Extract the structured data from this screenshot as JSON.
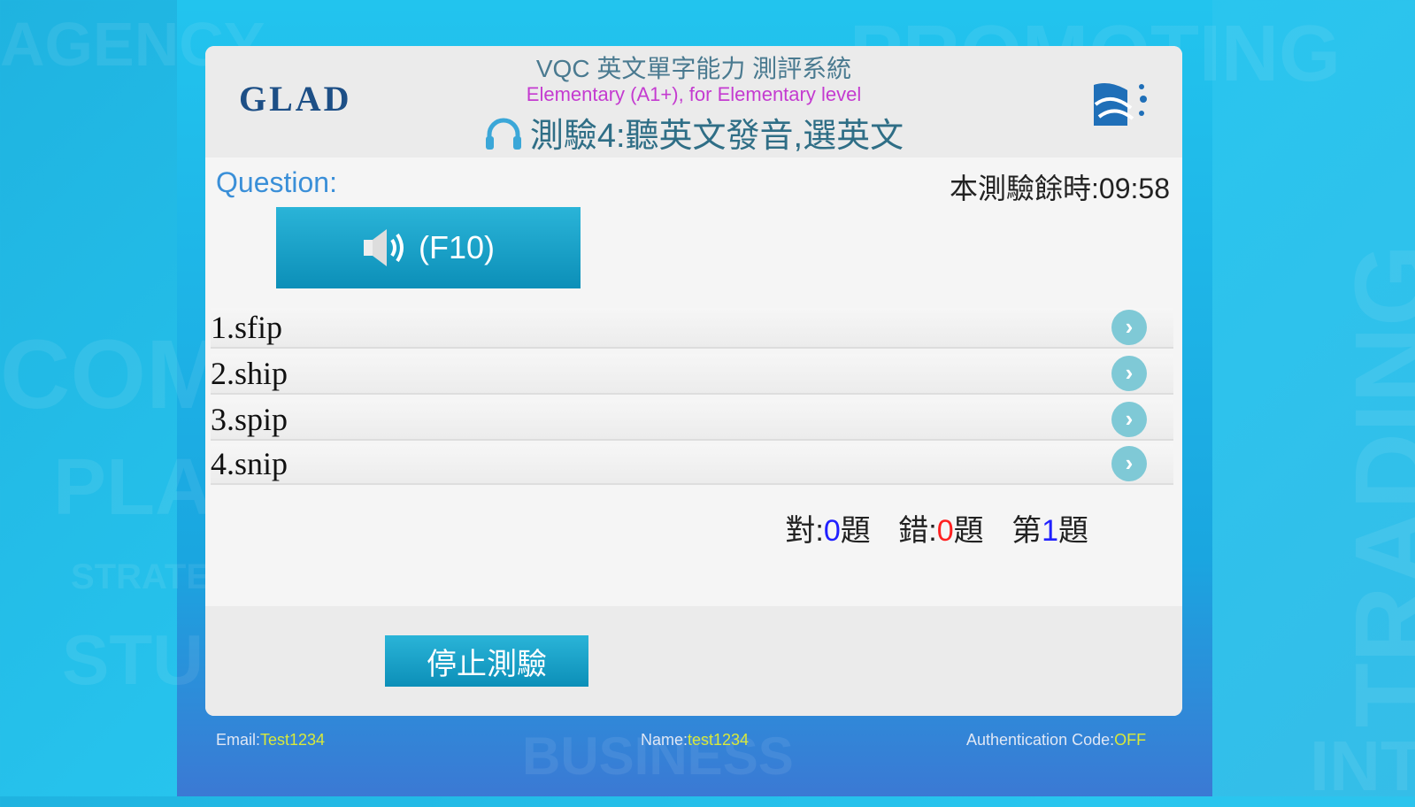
{
  "header": {
    "title": "VQC 英文單字能力 測評系統",
    "level": "Elementary (A1+), for Elementary level",
    "test": "測驗4:聽英文發音,選英文",
    "logo": "GLAD"
  },
  "question_label": "Question:",
  "timer": "本測驗餘時:09:58",
  "play_label": "(F10)",
  "options": [
    {
      "label": "1.sfip"
    },
    {
      "label": "2.ship"
    },
    {
      "label": "3.spip"
    },
    {
      "label": "4.snip"
    }
  ],
  "score": {
    "correct_label": "對:",
    "correct": "0",
    "correct_unit": "題",
    "wrong_label": "錯:",
    "wrong": "0",
    "wrong_unit": "題",
    "q_label": "第",
    "q": "1",
    "q_unit": "題"
  },
  "stop_label": "停止測驗",
  "footer": {
    "email_label": "Email:",
    "email": "Test1234",
    "name_label": "Name:",
    "name": "test1234",
    "auth_label": "Authentication Code:",
    "auth": "OFF"
  },
  "background_words": [
    "AGENCY",
    "PROMOTING",
    "COMM",
    "PLA",
    "STRATEGY",
    "STUD",
    "BUSINESS",
    "TRADING",
    "INTE"
  ],
  "colors": {
    "accent": "#1a9cc6",
    "correct": "#2020ff",
    "wrong": "#ff2020",
    "q": "#2020ff"
  }
}
